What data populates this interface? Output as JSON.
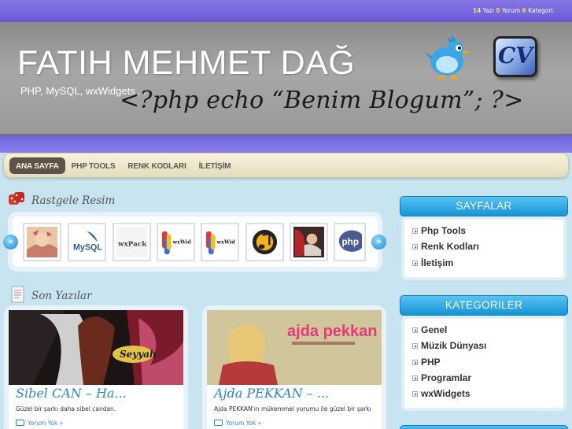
{
  "stats": {
    "posts_count": "14",
    "posts_label": "Yazı",
    "comments_count": "0",
    "comments_label": "Yorum",
    "categories_count": "6",
    "categories_label": "Kategori."
  },
  "header": {
    "title": "FATIH MEHMET DAĞ",
    "tagline": "PHP, MySQL, wxWidgets ...",
    "slogan": "<?php echo “Benim Blogum”; ?>",
    "cv_label": "CV"
  },
  "nav": {
    "items": [
      {
        "label": "ANA SAYFA"
      },
      {
        "label": "PHP TOOLS"
      },
      {
        "label": "RENK KODLARI"
      },
      {
        "label": "İLETİŞİM"
      }
    ]
  },
  "random_images": {
    "heading": "Rastgele Resim",
    "thumbs": [
      {
        "icon": "sezen-aksu-album-cover"
      },
      {
        "icon": "mysql-logo",
        "text": "MySQL"
      },
      {
        "icon": "wxpack-logo",
        "text": "wxPack"
      },
      {
        "icon": "wxwidgets-logo",
        "text": "wxWidgets"
      },
      {
        "icon": "wxwidgets-logo",
        "text": "wxWidgets"
      },
      {
        "icon": "music-note-icon"
      },
      {
        "icon": "album-cover-icon"
      },
      {
        "icon": "php-logo",
        "text": "php"
      }
    ]
  },
  "recent_posts": {
    "heading": "Son Yazılar",
    "posts": [
      {
        "title": "Sibel CAN – Ha...",
        "excerpt": "Güzel bir şarkı daha sibel candan.",
        "comments": "Yorum Yok »",
        "cover_text": "Seyyah"
      },
      {
        "title": "Ajda PEKKAN – ...",
        "excerpt": "Ajda PEKKAN'ın mükemmel yorumu ile güzel bir şarkı",
        "comments": "Yorum Yok »",
        "cover_text": "ajda pekkan"
      }
    ]
  },
  "sidebar": {
    "pages": {
      "title": "SAYFALAR",
      "items": [
        "Php Tools",
        "Renk Kodları",
        "İletişim"
      ]
    },
    "categories": {
      "title": "KATEGORILER",
      "items": [
        "Genel",
        "Müzik Dünyası",
        "PHP",
        "Programlar",
        "wxWidgets"
      ]
    }
  },
  "colors": {
    "topbar": "#7363dc",
    "header_gray": "#a0a0a0",
    "nav_active": "#5e5347",
    "sidebar_head": "#1694d6",
    "post_title": "#2b86c6",
    "page_bg": "#c8e4f0"
  }
}
